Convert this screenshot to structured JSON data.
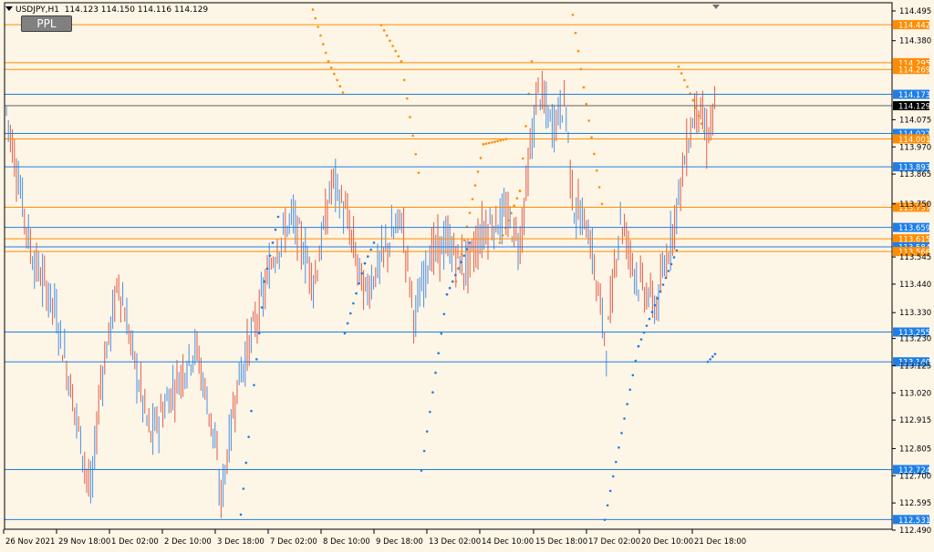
{
  "header": {
    "symbol": "USDJPY,H1",
    "ohlc": "114.123 114.150 114.116 114.129"
  },
  "button": {
    "label": "PPL"
  },
  "colors": {
    "background": "#fdf5e6",
    "bull": "#4a90e2",
    "bear": "#e05c4a",
    "blue_line": "#1e7ee6",
    "orange_line": "#ff8c00",
    "axis_text": "#000000"
  },
  "axis": {
    "y_ticks": [
      "114.495",
      "114.380",
      "114.075",
      "113.970",
      "113.865",
      "113.750",
      "113.545",
      "113.440",
      "113.330",
      "113.230",
      "113.125",
      "113.020",
      "112.915",
      "112.805",
      "112.700",
      "112.595",
      "112.490"
    ],
    "x_ticks": [
      "26 Nov 2021",
      "29 Nov 18:00",
      "1 Dec 02:00",
      "2 Dec 10:00",
      "3 Dec 18:00",
      "7 Dec 02:00",
      "8 Dec 10:00",
      "9 Dec 18:00",
      "13 Dec 02:00",
      "14 Dec 10:00",
      "15 Dec 18:00",
      "17 Dec 02:00",
      "20 Dec 10:00",
      "21 Dec 18:00"
    ]
  },
  "levels": [
    {
      "label": "114.442",
      "color": "orange"
    },
    {
      "label": "114.295",
      "color": "orange"
    },
    {
      "label": "114.269",
      "color": "orange"
    },
    {
      "label": "114.173",
      "color": "blue"
    },
    {
      "label": "114.129",
      "color": "current"
    },
    {
      "label": "114.022",
      "color": "blue"
    },
    {
      "label": "114.001",
      "color": "orange"
    },
    {
      "label": "113.893",
      "color": "blue"
    },
    {
      "label": "113.737",
      "color": "orange"
    },
    {
      "label": "113.659",
      "color": "blue"
    },
    {
      "label": "113.615",
      "color": "orange"
    },
    {
      "label": "113.584",
      "color": "blue"
    },
    {
      "label": "113.566",
      "color": "orange"
    },
    {
      "label": "113.255",
      "color": "blue"
    },
    {
      "label": "113.140",
      "color": "blue"
    },
    {
      "label": "112.724",
      "color": "blue"
    },
    {
      "label": "112.531",
      "color": "blue"
    }
  ]
}
